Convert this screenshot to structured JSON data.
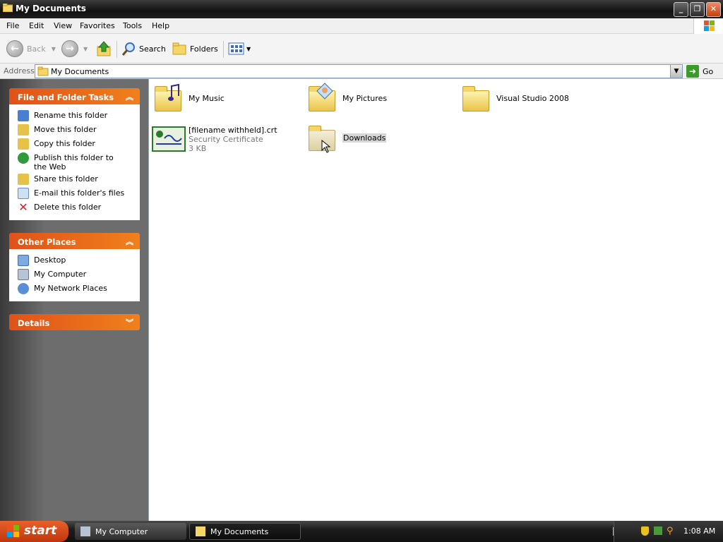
{
  "window": {
    "title": "My Documents"
  },
  "menu": [
    "File",
    "Edit",
    "View",
    "Favorites",
    "Tools",
    "Help"
  ],
  "toolbar": {
    "back": "Back",
    "search": "Search",
    "folders": "Folders"
  },
  "address": {
    "label": "Address",
    "value": "My Documents",
    "go": "Go"
  },
  "panels": {
    "file_tasks": {
      "title": "File and Folder Tasks",
      "items": [
        "Rename this folder",
        "Move this folder",
        "Copy this folder",
        "Publish this folder to the Web",
        "Share this folder",
        "E-mail this folder's files",
        "Delete this folder"
      ]
    },
    "other_places": {
      "title": "Other Places",
      "items": [
        "Desktop",
        "My Computer",
        "My Network Places"
      ]
    },
    "details": {
      "title": "Details"
    }
  },
  "items": [
    {
      "name": "My Music"
    },
    {
      "name": "My Pictures"
    },
    {
      "name": "Visual Studio 2008"
    },
    {
      "name": "[filename withheld].crt",
      "type": "Security Certificate",
      "size": "3 KB"
    },
    {
      "name": "Downloads"
    }
  ],
  "taskbar": {
    "start": "start",
    "buttons": [
      "My Computer",
      "My Documents"
    ],
    "clock": "1:08 AM"
  },
  "colors": {
    "accent": "#e8602a",
    "panel_header": "#e05218"
  }
}
